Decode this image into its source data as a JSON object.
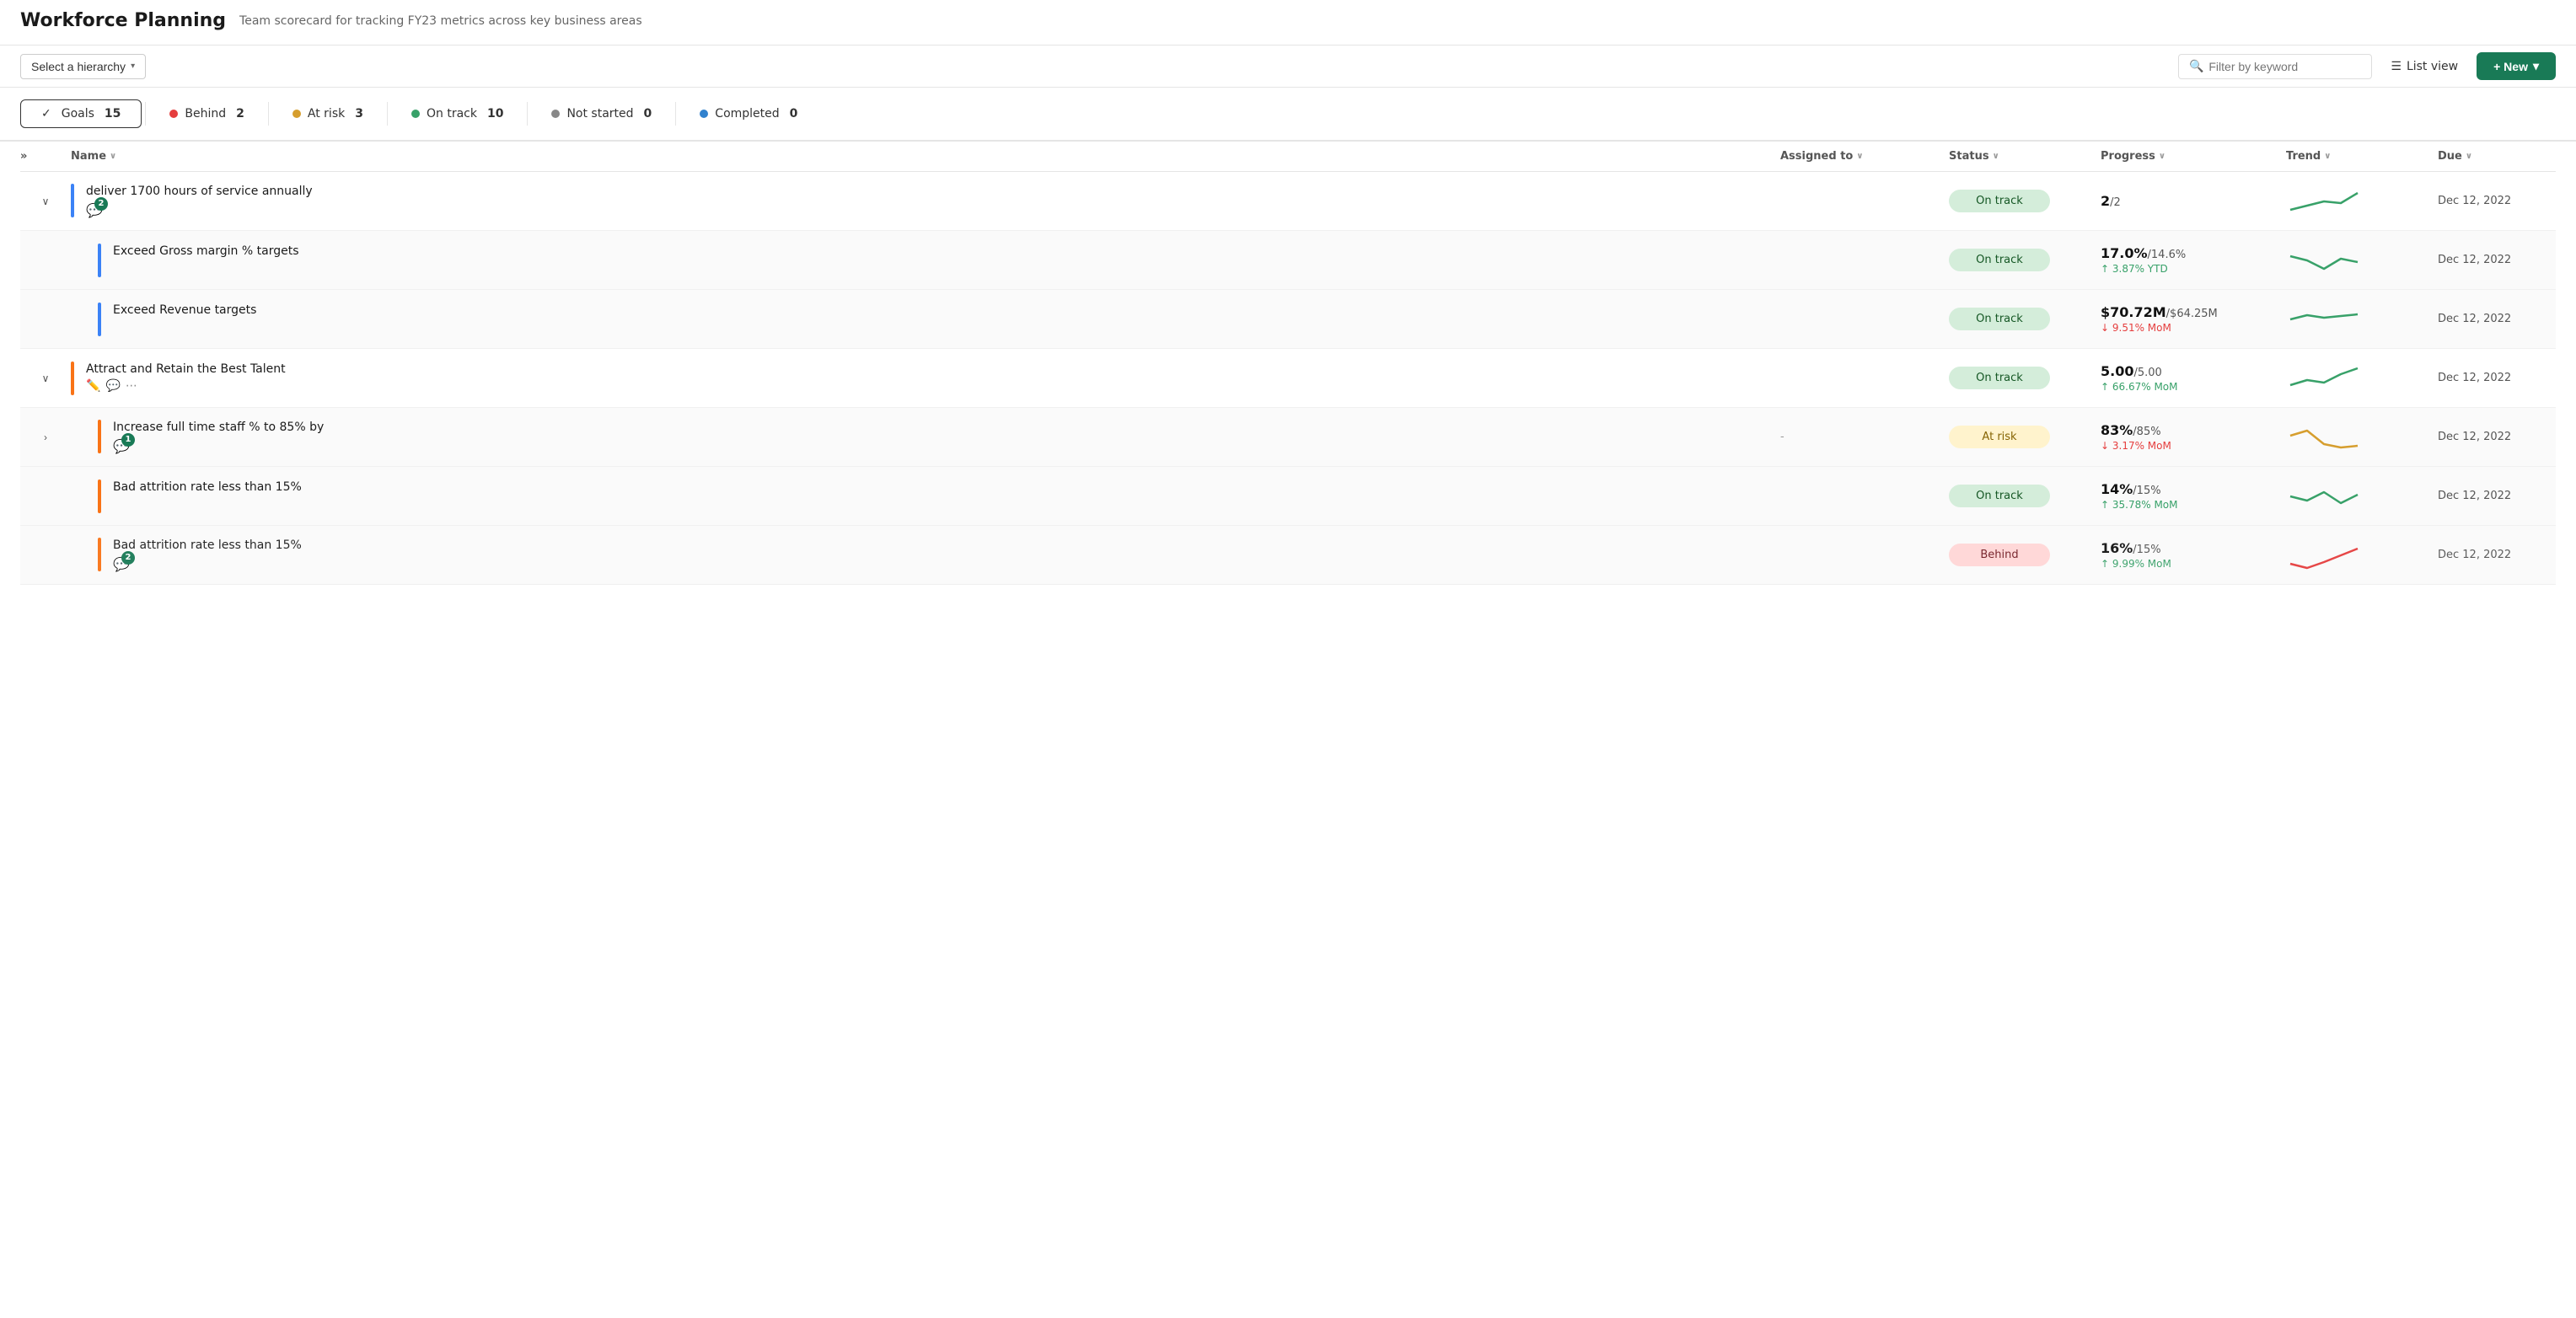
{
  "header": {
    "title": "Workforce Planning",
    "subtitle": "Team scorecard for tracking FY23 metrics across key business areas"
  },
  "toolbar": {
    "hierarchy_label": "Select a hierarchy",
    "hierarchy_chevron": "▾",
    "search_placeholder": "Filter by keyword",
    "list_view_label": "List view",
    "new_button_label": "+ New",
    "new_chevron": "▾"
  },
  "stats": {
    "goals_label": "Goals",
    "goals_count": "15",
    "behind_label": "Behind",
    "behind_count": "2",
    "atrisk_label": "At risk",
    "atrisk_count": "3",
    "ontrack_label": "On track",
    "ontrack_count": "10",
    "notstarted_label": "Not started",
    "notstarted_count": "0",
    "completed_label": "Completed",
    "completed_count": "0"
  },
  "table": {
    "columns": {
      "name": "Name",
      "assigned_to": "Assigned to",
      "status": "Status",
      "progress": "Progress",
      "trend": "Trend",
      "due": "Due"
    },
    "rows": [
      {
        "id": 1,
        "level": 0,
        "indicator": "blue",
        "expanded": true,
        "name": "deliver 1700 hours of service annually",
        "comment_count": "2",
        "assigned_to": "",
        "status": "On track",
        "status_type": "ontrack",
        "progress_main": "2",
        "progress_target": "/2",
        "progress_sub": "",
        "progress_sub_type": "",
        "due": "Dec 12, 2022",
        "trend_type": "up_green"
      },
      {
        "id": 2,
        "level": 1,
        "indicator": "blue",
        "name": "Exceed Gross margin % targets",
        "assigned_to": "",
        "status": "On track",
        "status_type": "ontrack",
        "progress_main": "17.0%",
        "progress_target": "/14.6%",
        "progress_sub": "↑ 3.87% YTD",
        "progress_sub_type": "up",
        "due": "Dec 12, 2022",
        "trend_type": "dip_green"
      },
      {
        "id": 3,
        "level": 1,
        "indicator": "blue",
        "name": "Exceed Revenue targets",
        "assigned_to": "",
        "status": "On track",
        "status_type": "ontrack",
        "progress_main": "$70.72M",
        "progress_target": "/$64.25M",
        "progress_sub": "↓ 9.51% MoM",
        "progress_sub_type": "down",
        "due": "Dec 12, 2022",
        "trend_type": "flat_green"
      },
      {
        "id": 4,
        "level": 0,
        "indicator": "orange",
        "expanded": true,
        "name": "Attract and Retain the Best Talent",
        "has_edit": true,
        "has_comment": true,
        "has_more": true,
        "assigned_to": "",
        "status": "On track",
        "status_type": "ontrack",
        "progress_main": "5.00",
        "progress_target": "/5.00",
        "progress_sub": "↑ 66.67% MoM",
        "progress_sub_type": "up",
        "due": "Dec 12, 2022",
        "trend_type": "up_green2"
      },
      {
        "id": 5,
        "level": 1,
        "indicator": "orange",
        "has_expand": true,
        "comment_count": "1",
        "name": "Increase full time staff % to 85% by",
        "assigned_to": "-",
        "status": "At risk",
        "status_type": "atrisk",
        "progress_main": "83%",
        "progress_target": "/85%",
        "progress_sub": "↓ 3.17% MoM",
        "progress_sub_type": "down",
        "due": "Dec 12, 2022",
        "trend_type": "dip_yellow"
      },
      {
        "id": 6,
        "level": 1,
        "indicator": "orange",
        "name": "Bad attrition rate less than 15%",
        "assigned_to": "",
        "status": "On track",
        "status_type": "ontrack",
        "progress_main": "14%",
        "progress_target": "/15%",
        "progress_sub": "↑ 35.78% MoM",
        "progress_sub_type": "up",
        "due": "Dec 12, 2022",
        "trend_type": "dip_green2"
      },
      {
        "id": 7,
        "level": 1,
        "indicator": "orange",
        "comment_count": "2",
        "name": "Bad attrition rate less than 15%",
        "assigned_to": "",
        "status": "Behind",
        "status_type": "behind",
        "progress_main": "16%",
        "progress_target": "/15%",
        "progress_sub": "↑ 9.99% MoM",
        "progress_sub_type": "up",
        "due": "Dec 12, 2022",
        "trend_type": "up_red"
      }
    ]
  }
}
